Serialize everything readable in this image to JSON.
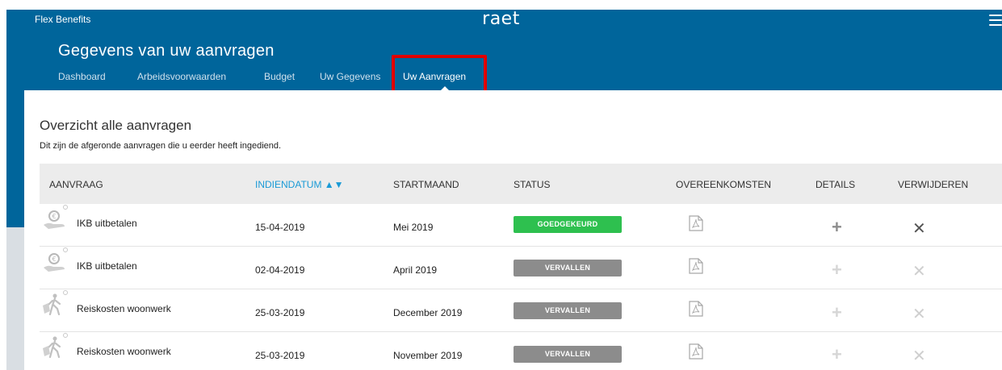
{
  "app": {
    "name": "Flex Benefits",
    "brand": "raet",
    "menu_icon": "hamburger-icon"
  },
  "header": {
    "title": "Gegevens van uw aanvragen",
    "tabs": [
      {
        "label": "Dashboard",
        "active": false
      },
      {
        "label": "Arbeidsvoorwaarden",
        "active": false
      },
      {
        "label": "Budget",
        "active": false
      },
      {
        "label": "Uw Gegevens",
        "active": false
      },
      {
        "label": "Uw Aanvragen",
        "active": true
      }
    ]
  },
  "section": {
    "title": "Overzicht alle aanvragen",
    "subtitle": "Dit zijn de afgeronde aanvragen die u eerder heeft ingediend."
  },
  "table": {
    "columns": {
      "aanvraag": "AANVRAAG",
      "indiendatum": "INDIENDATUM ▲▼",
      "startmaand": "STARTMAAND",
      "status": "STATUS",
      "overeenkomsten": "OVEREENKOMSTEN",
      "details": "DETAILS",
      "verwijderen": "VERWIJDEREN"
    },
    "rows": [
      {
        "icon": "money-hand-icon",
        "aanvraag": "IKB uitbetalen",
        "indiendatum": "15-04-2019",
        "startmaand": "Mei 2019",
        "status": "GOEDGEKEURD",
        "status_kind": "approved"
      },
      {
        "icon": "money-hand-icon",
        "aanvraag": "IKB uitbetalen",
        "indiendatum": "02-04-2019",
        "startmaand": "April 2019",
        "status": "VERVALLEN",
        "status_kind": "expired"
      },
      {
        "icon": "commute-icon",
        "aanvraag": "Reiskosten woonwerk",
        "indiendatum": "25-03-2019",
        "startmaand": "December 2019",
        "status": "VERVALLEN",
        "status_kind": "expired"
      },
      {
        "icon": "commute-icon",
        "aanvraag": "Reiskosten woonwerk",
        "indiendatum": "25-03-2019",
        "startmaand": "November 2019",
        "status": "VERVALLEN",
        "status_kind": "expired"
      }
    ]
  },
  "colors": {
    "header": "#00659b",
    "approved": "#2ec04f",
    "expired": "#8c8c8c",
    "sort_link": "#1a9ad6",
    "highlight": "#e00000"
  }
}
